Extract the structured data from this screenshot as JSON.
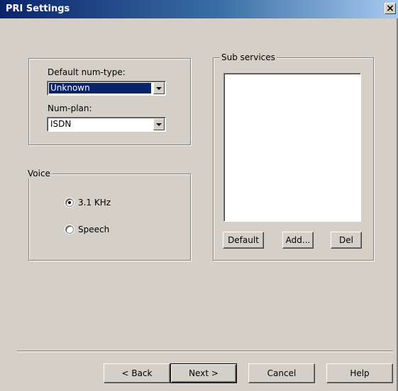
{
  "window": {
    "title": "PRI Settings",
    "close_symbol": "×"
  },
  "numbering": {
    "default_num_type_label": "Default num-type:",
    "default_num_type_value": "Unknown",
    "num_plan_label": "Num-plan:",
    "num_plan_value": "ISDN"
  },
  "voice": {
    "group_label": "Voice",
    "options": [
      {
        "label": "3.1 KHz",
        "selected": true
      },
      {
        "label": "Speech",
        "selected": false
      }
    ]
  },
  "sub_services": {
    "group_label": "Sub services",
    "items": [],
    "buttons": {
      "default": "Default",
      "add": "Add...",
      "del": "Del"
    }
  },
  "footer": {
    "back": "< Back",
    "next": "Next >",
    "cancel": "Cancel",
    "help": "Help"
  }
}
